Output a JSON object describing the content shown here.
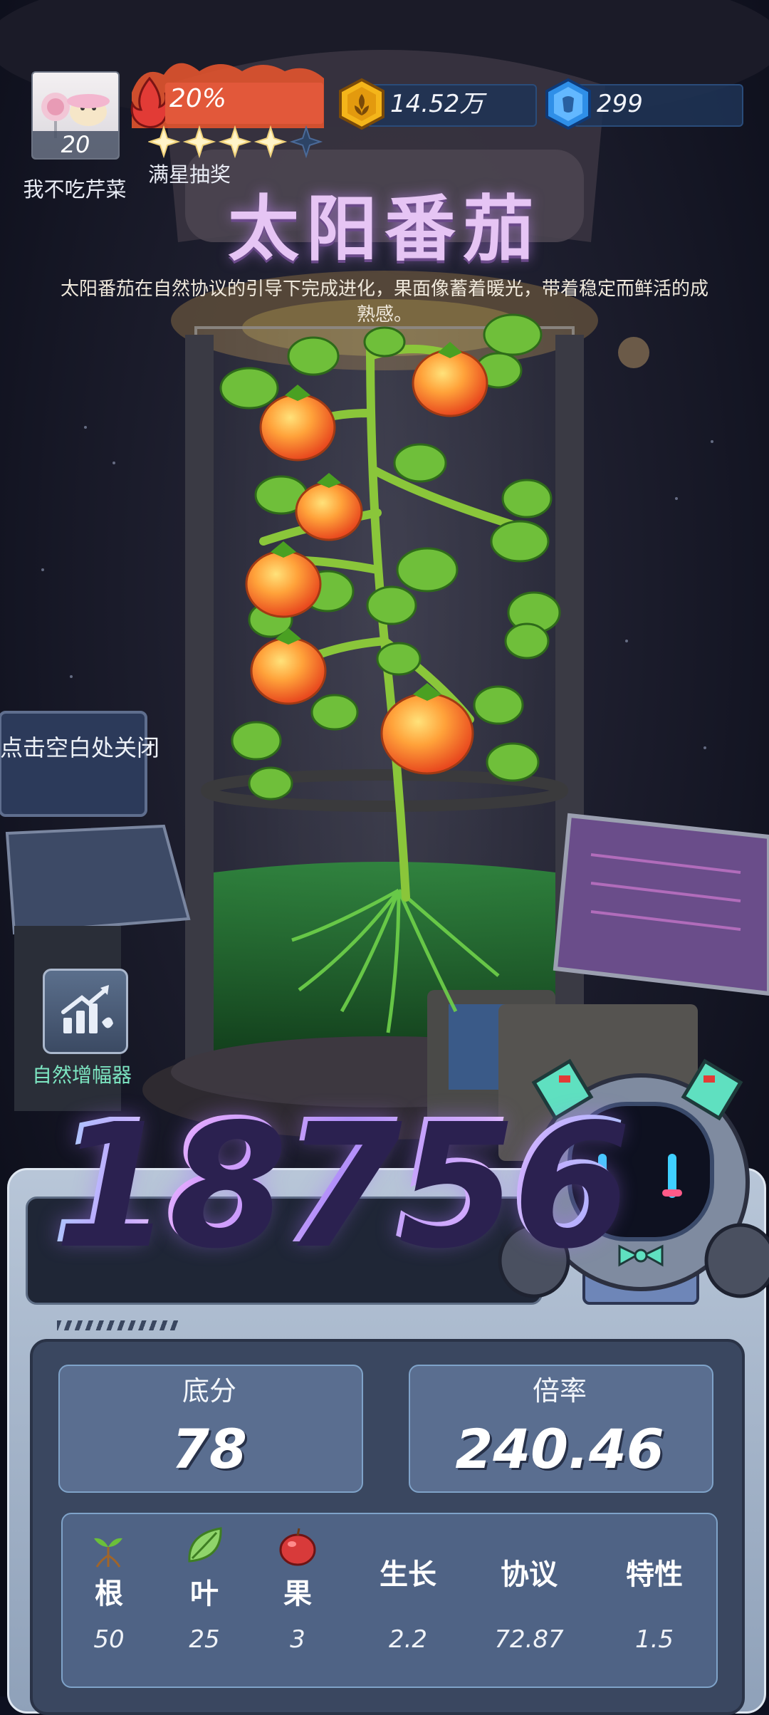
{
  "player": {
    "name": "我不吃芹菜",
    "level": "20"
  },
  "heat": {
    "percent_text": "20%",
    "fill_fraction": 0.2,
    "color": "#e0583a"
  },
  "stars": {
    "filled": 4,
    "total": 5,
    "label": "满星抽奖"
  },
  "currencies": {
    "coins": {
      "value": "14.52万",
      "icon": "gold-coin-icon",
      "color": "#f0b21c"
    },
    "gems": {
      "value": "299",
      "icon": "blue-gem-icon",
      "color": "#3aa3ff"
    }
  },
  "plant": {
    "title": "太阳番茄",
    "description": "太阳番茄在自然协议的引导下完成进化，果面像蓄着暖光，带着稳定而鲜活的成熟感。"
  },
  "hints": {
    "close": "点击空白处关闭"
  },
  "amplifier": {
    "label": "自然增幅器",
    "icon": "growth-chart-icon"
  },
  "score": {
    "value": "18756"
  },
  "stats": {
    "base": {
      "label": "底分",
      "value": "78"
    },
    "multiplier": {
      "label": "倍率",
      "value": "240.46"
    }
  },
  "attributes": [
    {
      "name": "根",
      "value": "50",
      "icon": "root-sprout-icon"
    },
    {
      "name": "叶",
      "value": "25",
      "icon": "leaf-icon"
    },
    {
      "name": "果",
      "value": "3",
      "icon": "apple-icon"
    },
    {
      "name": "生长",
      "value": "2.2"
    },
    {
      "name": "协议",
      "value": "72.87"
    },
    {
      "name": "特性",
      "value": "1.5"
    }
  ],
  "colors": {
    "accent_green": "#7de6c2",
    "panel": "#3a4760",
    "title": "#e6c5f4"
  }
}
